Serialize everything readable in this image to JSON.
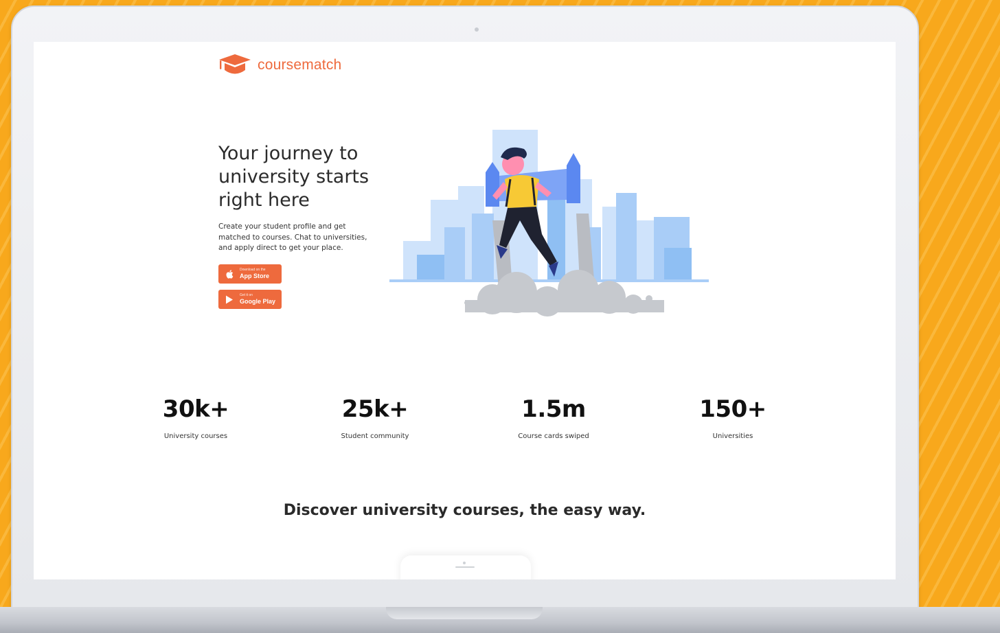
{
  "brand": {
    "name_part1": "course",
    "name_part2": "match",
    "accent_color": "#ee6a3d",
    "background_color": "#f8a81c"
  },
  "hero": {
    "title": "Your journey to university starts right here",
    "description": "Create your student profile and get matched to courses. Chat to universities, and apply direct to get your place.",
    "app_store": {
      "small": "Download on the",
      "big": "App Store",
      "icon": "apple-icon"
    },
    "google_play": {
      "small": "Get it on",
      "big": "Google Play",
      "icon": "play-icon"
    }
  },
  "stats": [
    {
      "value": "30k+",
      "label": "University courses"
    },
    {
      "value": "25k+",
      "label": "Student community"
    },
    {
      "value": "1.5m",
      "label": "Course cards swiped"
    },
    {
      "value": "150+",
      "label": "Universities"
    }
  ],
  "discover": {
    "heading": "Discover university courses, the easy way."
  }
}
